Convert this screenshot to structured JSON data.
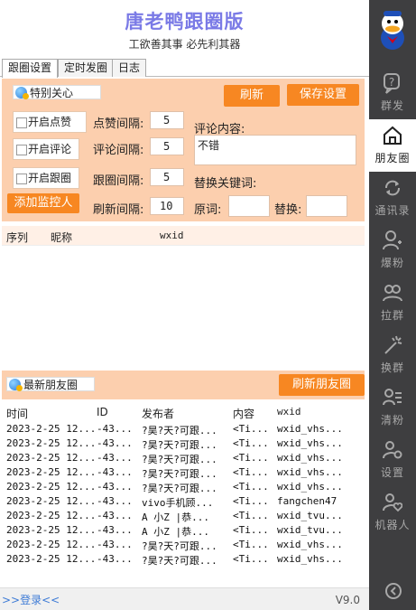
{
  "app": {
    "title": "唐老鸭跟圈版",
    "subtitle": "工欲善其事 必先利其器",
    "version": "V9.0",
    "login_link": ">>登录<<"
  },
  "tabs": [
    {
      "label": "跟圈设置",
      "active": true
    },
    {
      "label": "定时发圈",
      "active": false
    },
    {
      "label": "日志",
      "active": false
    }
  ],
  "special": {
    "group_label": "特别关心",
    "refresh_button": "刷新",
    "save_button": "保存设置",
    "like_checkbox": "开启点赞",
    "comment_checkbox": "开启评论",
    "follow_checkbox": "开启跟圈",
    "add_button": "添加监控人",
    "like_interval_label": "点赞间隔:",
    "like_interval": "5",
    "comment_interval_label": "评论间隔:",
    "comment_interval": "5",
    "follow_interval_label": "跟圈间隔:",
    "follow_interval": "5",
    "refresh_interval_label": "刷新间隔:",
    "refresh_interval": "10",
    "comment_content_label": "评论内容:",
    "comment_content": "不错",
    "replace_label": "替换关键词:",
    "original_label": "原词:",
    "original_value": "",
    "replace_with_label": "替换:",
    "replace_with_value": ""
  },
  "watch_list": {
    "columns": [
      "序列",
      "昵称",
      "wxid"
    ]
  },
  "moments": {
    "group_label": "最新朋友圈",
    "refresh_button": "刷新朋友圈",
    "columns": [
      "时间",
      "ID",
      "发布者",
      "内容",
      "wxid"
    ],
    "rows": [
      [
        "2023-2-25 12...",
        "-43...",
        "?昊?天?可跟...",
        "<Ti...",
        "wxid_vhs..."
      ],
      [
        "2023-2-25 12...",
        "-43...",
        "?昊?天?可跟...",
        "<Ti...",
        "wxid_vhs..."
      ],
      [
        "2023-2-25 12...",
        "-43...",
        "?昊?天?可跟...",
        "<Ti...",
        "wxid_vhs..."
      ],
      [
        "2023-2-25 12...",
        "-43...",
        "?昊?天?可跟...",
        "<Ti...",
        "wxid_vhs..."
      ],
      [
        "2023-2-25 12...",
        "-43...",
        "?昊?天?可跟...",
        "<Ti...",
        "wxid_vhs..."
      ],
      [
        "2023-2-25 12...",
        "-43...",
        "vivo手机顾...",
        "<Ti...",
        "fangchen47"
      ],
      [
        "2023-2-25 12...",
        "-43...",
        "A 小Z  |恭...",
        "<Ti...",
        "wxid_tvu..."
      ],
      [
        "2023-2-25 12...",
        "-43...",
        "A 小Z  |恭...",
        "<Ti...",
        "wxid_tvu..."
      ],
      [
        "2023-2-25 12...",
        "-43...",
        "?昊?天?可跟...",
        "<Ti...",
        "wxid_vhs..."
      ],
      [
        "2023-2-25 12...",
        "-43...",
        "?昊?天?可跟...",
        "<Ti...",
        "wxid_vhs..."
      ]
    ]
  },
  "sidebar": {
    "items": [
      {
        "label": "群发",
        "icon": "question-chat-icon",
        "active": false
      },
      {
        "label": "朋友圈",
        "icon": "home-icon",
        "active": true
      },
      {
        "label": "通讯录",
        "icon": "sync-icon",
        "active": false
      },
      {
        "label": "爆粉",
        "icon": "add-user-icon",
        "active": false
      },
      {
        "label": "拉群",
        "icon": "group-icon",
        "active": false
      },
      {
        "label": "换群",
        "icon": "magic-wand-icon",
        "active": false
      },
      {
        "label": "清粉",
        "icon": "user-list-icon",
        "active": false
      },
      {
        "label": "设置",
        "icon": "user-gear-icon",
        "active": false
      },
      {
        "label": "机器人",
        "icon": "user-heart-icon",
        "active": false
      }
    ],
    "logo_icon": "donald-duck-avatar-icon",
    "back_icon": "back-circle-icon"
  },
  "colors": {
    "accent": "#f78722",
    "panel": "#fccfae",
    "title": "#7a7ae6",
    "sidebar": "#3e3e40"
  }
}
